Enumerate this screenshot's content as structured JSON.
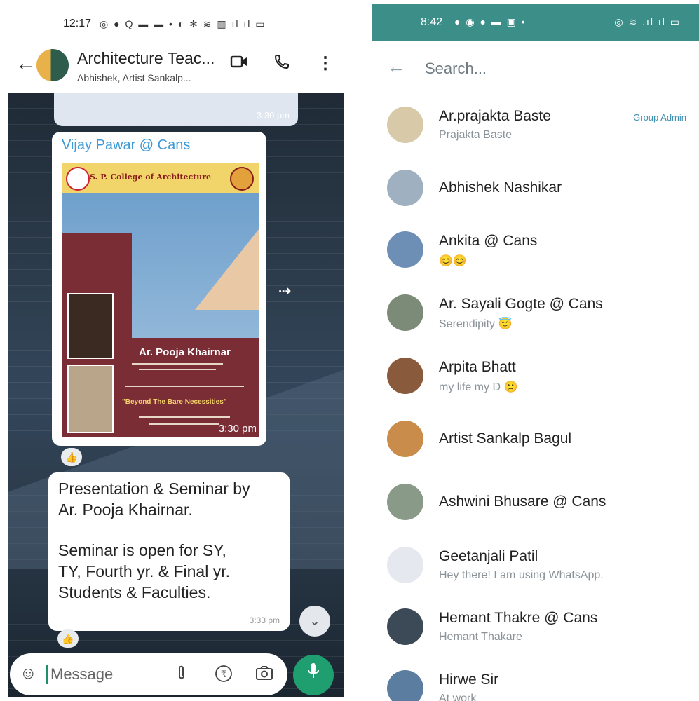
{
  "left": {
    "status": {
      "time": "12:17",
      "icons": "◎ ● Q ▬ ▬ • ◐ ✻ ≋ ▥ ıl ıl ▭"
    },
    "header": {
      "title": "Architecture Teac...",
      "subtitle": "Abhishek, Artist Sankalp..."
    },
    "prev_message": {
      "time": "3:30 pm"
    },
    "image_message": {
      "sender": "Vijay Pawar @ Cans",
      "poster_college": "S. P. College of Architecture",
      "poster_name": "Ar. Pooja Khairnar",
      "poster_topic": "\"Beyond The Bare Necessities\"",
      "time": "3:30 pm",
      "reaction": "👍"
    },
    "text_message": {
      "lines": [
        "Presentation & Seminar by",
        "Ar. Pooja Khairnar.",
        "",
        "Seminar is open for SY,",
        "TY, Fourth yr. & Final yr.",
        "Students & Faculties."
      ],
      "time": "3:33 pm",
      "reaction": "👍"
    },
    "composer": {
      "placeholder": "Message"
    }
  },
  "right": {
    "status": {
      "time": "8:42",
      "icons_left": "● ◉ ● ▬ ▣ •",
      "icons_right": "◎ ≋ .ıl ıl ▭"
    },
    "search": {
      "placeholder": "Search..."
    },
    "members": [
      {
        "name": "Ar.prajakta Baste",
        "sub": "Prajakta Baste",
        "badge": "Group Admin",
        "color": "#d8c9a8"
      },
      {
        "name": "Abhishek Nashikar",
        "sub": "",
        "badge": "",
        "color": "#9fb0c0"
      },
      {
        "name": "Ankita @ Cans",
        "sub": "😊😊",
        "badge": "",
        "color": "#6d8fb5"
      },
      {
        "name": "Ar. Sayali Gogte @ Cans",
        "sub": "Serendipity 😇",
        "badge": "",
        "color": "#7c8a78"
      },
      {
        "name": "Arpita Bhatt",
        "sub": "my life  my D 🙁",
        "badge": "",
        "color": "#8a5a3c"
      },
      {
        "name": "Artist Sankalp Bagul",
        "sub": "",
        "badge": "",
        "color": "#c98c4a"
      },
      {
        "name": "Ashwini Bhusare @ Cans",
        "sub": "",
        "badge": "",
        "color": "#8a9a88"
      },
      {
        "name": "Geetanjali Patil",
        "sub": "Hey there! I am using WhatsApp.",
        "badge": "",
        "color": "#e6e8f0"
      },
      {
        "name": "Hemant Thakre @ Cans",
        "sub": "Hemant Thakare",
        "badge": "",
        "color": "#3c4a58"
      },
      {
        "name": "Hirwe Sir",
        "sub": "At work",
        "badge": "",
        "color": "#5a7da0"
      }
    ]
  }
}
